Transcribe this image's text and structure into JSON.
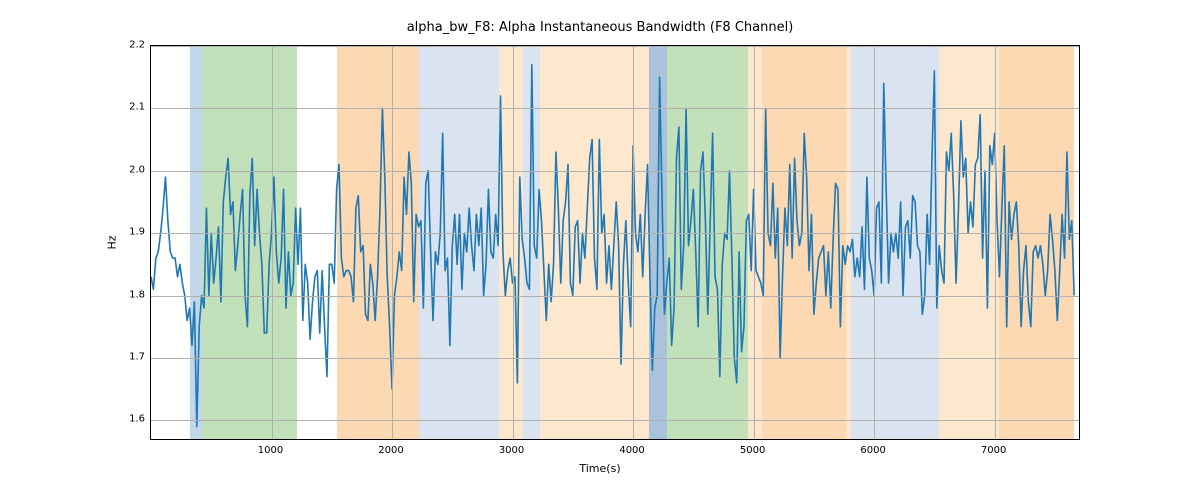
{
  "chart_data": {
    "type": "line",
    "title": "alpha_bw_F8: Alpha Instantaneous Bandwidth (F8 Channel)",
    "xlabel": "Time(s)",
    "ylabel": "Hz",
    "xlim": [
      0,
      7700
    ],
    "ylim": [
      1.57,
      2.2
    ],
    "x_ticks": [
      1000,
      2000,
      3000,
      4000,
      5000,
      6000,
      7000
    ],
    "y_ticks": [
      1.6,
      1.7,
      1.8,
      1.9,
      2.0,
      2.1,
      2.2
    ],
    "line_color": "#1f77b4",
    "spans": [
      {
        "x0": 320,
        "x1": 420,
        "color": "#c3d7ea"
      },
      {
        "x0": 420,
        "x1": 1210,
        "color": "#c2e0ba"
      },
      {
        "x0": 1540,
        "x1": 2220,
        "color": "#fcd9b2"
      },
      {
        "x0": 2220,
        "x1": 2890,
        "color": "#d9e4f0"
      },
      {
        "x0": 2890,
        "x1": 3090,
        "color": "#fde7cd"
      },
      {
        "x0": 3090,
        "x1": 3230,
        "color": "#d9e4f0"
      },
      {
        "x0": 3230,
        "x1": 4130,
        "color": "#fde7cd"
      },
      {
        "x0": 4130,
        "x1": 4280,
        "color": "#a9c3da"
      },
      {
        "x0": 4280,
        "x1": 4950,
        "color": "#c2e0ba"
      },
      {
        "x0": 4950,
        "x1": 5070,
        "color": "#fde7cd"
      },
      {
        "x0": 5070,
        "x1": 5770,
        "color": "#fcd9b2"
      },
      {
        "x0": 5770,
        "x1": 5810,
        "color": "#fde7cd"
      },
      {
        "x0": 5810,
        "x1": 5870,
        "color": "#d9e4f0"
      },
      {
        "x0": 5870,
        "x1": 6540,
        "color": "#d9e4f0"
      },
      {
        "x0": 6540,
        "x1": 7040,
        "color": "#fde7cd"
      },
      {
        "x0": 7040,
        "x1": 7660,
        "color": "#fcd9b2"
      }
    ],
    "x": [
      0,
      20,
      40,
      60,
      80,
      100,
      120,
      140,
      160,
      180,
      200,
      220,
      240,
      260,
      280,
      300,
      320,
      340,
      360,
      380,
      400,
      420,
      440,
      460,
      480,
      500,
      520,
      540,
      560,
      580,
      600,
      620,
      640,
      660,
      680,
      700,
      720,
      740,
      760,
      780,
      800,
      820,
      840,
      860,
      880,
      900,
      920,
      940,
      960,
      980,
      1000,
      1020,
      1040,
      1060,
      1080,
      1100,
      1120,
      1140,
      1160,
      1180,
      1200,
      1220,
      1240,
      1260,
      1280,
      1300,
      1320,
      1340,
      1360,
      1380,
      1400,
      1420,
      1440,
      1460,
      1480,
      1500,
      1520,
      1540,
      1560,
      1580,
      1600,
      1620,
      1640,
      1660,
      1680,
      1700,
      1720,
      1740,
      1760,
      1780,
      1800,
      1820,
      1840,
      1860,
      1880,
      1900,
      1920,
      1940,
      1960,
      1980,
      2000,
      2020,
      2040,
      2060,
      2080,
      2100,
      2120,
      2140,
      2160,
      2180,
      2200,
      2220,
      2240,
      2260,
      2280,
      2300,
      2320,
      2340,
      2360,
      2380,
      2400,
      2420,
      2440,
      2460,
      2480,
      2500,
      2520,
      2540,
      2560,
      2580,
      2600,
      2620,
      2640,
      2660,
      2680,
      2700,
      2720,
      2740,
      2760,
      2780,
      2800,
      2820,
      2840,
      2860,
      2880,
      2900,
      2920,
      2940,
      2960,
      2980,
      3000,
      3020,
      3040,
      3060,
      3080,
      3100,
      3120,
      3140,
      3160,
      3180,
      3200,
      3220,
      3240,
      3260,
      3280,
      3300,
      3320,
      3340,
      3360,
      3380,
      3400,
      3420,
      3440,
      3460,
      3480,
      3500,
      3520,
      3540,
      3560,
      3580,
      3600,
      3620,
      3640,
      3660,
      3680,
      3700,
      3720,
      3740,
      3760,
      3780,
      3800,
      3820,
      3840,
      3860,
      3880,
      3900,
      3920,
      3940,
      3960,
      3980,
      4000,
      4020,
      4040,
      4060,
      4080,
      4100,
      4120,
      4140,
      4160,
      4180,
      4200,
      4220,
      4240,
      4260,
      4280,
      4300,
      4320,
      4340,
      4360,
      4380,
      4400,
      4420,
      4440,
      4460,
      4480,
      4500,
      4520,
      4540,
      4560,
      4580,
      4600,
      4620,
      4640,
      4660,
      4680,
      4700,
      4720,
      4740,
      4760,
      4780,
      4800,
      4820,
      4840,
      4860,
      4880,
      4900,
      4920,
      4940,
      4960,
      4980,
      5000,
      5020,
      5040,
      5060,
      5080,
      5100,
      5120,
      5140,
      5160,
      5180,
      5200,
      5220,
      5240,
      5260,
      5280,
      5300,
      5320,
      5340,
      5360,
      5380,
      5400,
      5420,
      5440,
      5460,
      5480,
      5500,
      5520,
      5540,
      5560,
      5580,
      5600,
      5620,
      5640,
      5660,
      5680,
      5700,
      5720,
      5740,
      5760,
      5780,
      5800,
      5820,
      5840,
      5860,
      5880,
      5900,
      5920,
      5940,
      5960,
      5980,
      6000,
      6020,
      6040,
      6060,
      6080,
      6100,
      6120,
      6140,
      6160,
      6180,
      6200,
      6220,
      6240,
      6260,
      6280,
      6300,
      6320,
      6340,
      6360,
      6380,
      6400,
      6420,
      6440,
      6460,
      6480,
      6500,
      6520,
      6540,
      6560,
      6580,
      6600,
      6620,
      6640,
      6660,
      6680,
      6700,
      6720,
      6740,
      6760,
      6780,
      6800,
      6820,
      6840,
      6860,
      6880,
      6900,
      6920,
      6940,
      6960,
      6980,
      7000,
      7020,
      7040,
      7060,
      7080,
      7100,
      7120,
      7140,
      7160,
      7180,
      7200,
      7220,
      7240,
      7260,
      7280,
      7300,
      7320,
      7340,
      7360,
      7380,
      7400,
      7420,
      7440,
      7460,
      7480,
      7500,
      7520,
      7540,
      7560,
      7580,
      7600,
      7620,
      7640,
      7660
    ],
    "values": [
      1.83,
      1.81,
      1.86,
      1.87,
      1.9,
      1.94,
      1.99,
      1.92,
      1.87,
      1.86,
      1.86,
      1.83,
      1.85,
      1.82,
      1.8,
      1.76,
      1.78,
      1.72,
      1.79,
      1.59,
      1.75,
      1.8,
      1.78,
      1.94,
      1.8,
      1.9,
      1.82,
      1.86,
      1.91,
      1.79,
      1.95,
      1.99,
      2.02,
      1.93,
      1.95,
      1.84,
      1.88,
      1.93,
      1.97,
      1.8,
      1.75,
      1.96,
      2.02,
      1.88,
      1.97,
      1.9,
      1.85,
      1.74,
      1.74,
      1.85,
      1.9,
      1.99,
      1.87,
      1.82,
      1.86,
      1.97,
      1.78,
      1.87,
      1.8,
      1.82,
      1.94,
      1.85,
      1.94,
      1.76,
      1.85,
      1.82,
      1.73,
      1.79,
      1.83,
      1.84,
      1.74,
      1.84,
      1.75,
      1.67,
      1.85,
      1.85,
      1.82,
      1.97,
      2.01,
      1.86,
      1.83,
      1.84,
      1.84,
      1.83,
      1.79,
      1.94,
      1.96,
      1.87,
      1.88,
      1.77,
      1.76,
      1.85,
      1.82,
      1.76,
      1.83,
      1.94,
      2.1,
      1.99,
      1.83,
      1.75,
      1.65,
      1.8,
      1.83,
      1.87,
      1.84,
      1.99,
      1.93,
      2.03,
      1.98,
      1.79,
      1.93,
      1.91,
      1.92,
      1.78,
      1.98,
      2.0,
      1.87,
      1.76,
      1.87,
      1.85,
      1.9,
      2.06,
      1.84,
      1.86,
      1.72,
      1.88,
      1.93,
      1.85,
      1.93,
      1.81,
      1.9,
      1.87,
      1.94,
      1.88,
      1.84,
      1.93,
      1.88,
      1.94,
      1.8,
      1.85,
      1.97,
      1.87,
      1.86,
      1.93,
      1.88,
      2.12,
      1.87,
      1.8,
      1.84,
      1.86,
      1.82,
      1.83,
      1.66,
      1.99,
      1.89,
      1.86,
      1.82,
      1.81,
      2.17,
      1.88,
      1.86,
      1.97,
      1.92,
      1.84,
      1.76,
      1.85,
      1.79,
      1.85,
      2.03,
      1.94,
      1.82,
      1.92,
      1.95,
      2.01,
      1.82,
      1.8,
      1.91,
      1.92,
      1.82,
      1.9,
      1.86,
      1.94,
      2.02,
      2.05,
      1.86,
      1.81,
      2.05,
      1.9,
      1.93,
      1.82,
      1.88,
      1.81,
      1.88,
      1.95,
      1.88,
      1.69,
      1.85,
      1.92,
      1.82,
      1.75,
      2.04,
      1.9,
      1.87,
      1.93,
      1.83,
      1.93,
      2.01,
      1.83,
      1.68,
      1.78,
      1.8,
      2.15,
      1.96,
      1.77,
      1.82,
      1.86,
      1.72,
      1.78,
      2.02,
      2.07,
      1.81,
      1.88,
      2.1,
      1.88,
      1.92,
      1.97,
      1.87,
      1.75,
      2.0,
      2.03,
      1.92,
      1.77,
      1.92,
      2.06,
      1.83,
      1.81,
      1.67,
      1.85,
      1.9,
      1.89,
      2.0,
      1.86,
      1.7,
      1.66,
      1.87,
      1.71,
      1.75,
      1.92,
      1.93,
      1.84,
      1.97,
      1.84,
      1.83,
      1.82,
      1.8,
      2.1,
      1.9,
      1.88,
      1.98,
      1.86,
      1.94,
      1.7,
      1.83,
      1.94,
      1.88,
      2.01,
      1.86,
      2.02,
      1.92,
      1.88,
      1.9,
      2.06,
      1.99,
      1.84,
      1.93,
      1.77,
      1.82,
      1.86,
      1.87,
      1.88,
      1.8,
      1.87,
      1.78,
      1.89,
      1.98,
      1.97,
      1.75,
      1.88,
      1.85,
      1.88,
      1.87,
      1.89,
      1.83,
      1.86,
      1.83,
      1.91,
      1.81,
      1.99,
      1.86,
      1.84,
      1.8,
      1.94,
      1.95,
      1.82,
      2.14,
      1.97,
      1.82,
      1.9,
      1.87,
      1.9,
      1.86,
      1.95,
      1.8,
      1.91,
      1.92,
      1.86,
      1.96,
      1.95,
      1.88,
      1.87,
      1.77,
      1.8,
      1.93,
      1.85,
      2.02,
      2.16,
      1.78,
      1.88,
      1.84,
      1.82,
      2.03,
      2.0,
      2.06,
      1.96,
      1.82,
      1.94,
      2.08,
      1.99,
      2.02,
      1.9,
      1.95,
      1.91,
      2.01,
      2.02,
      2.09,
      1.86,
      2.0,
      1.78,
      2.04,
      2.01,
      2.06,
      1.92,
      1.83,
      1.94,
      2.04,
      1.75,
      1.95,
      1.89,
      1.93,
      1.95,
      1.88,
      1.75,
      1.84,
      1.88,
      1.79,
      1.75,
      1.87,
      1.88,
      1.86,
      1.88,
      1.85,
      1.8,
      1.84,
      1.93,
      1.89,
      1.84,
      1.76,
      1.84,
      1.93,
      1.86,
      2.03,
      1.89,
      1.92,
      1.8
    ]
  }
}
